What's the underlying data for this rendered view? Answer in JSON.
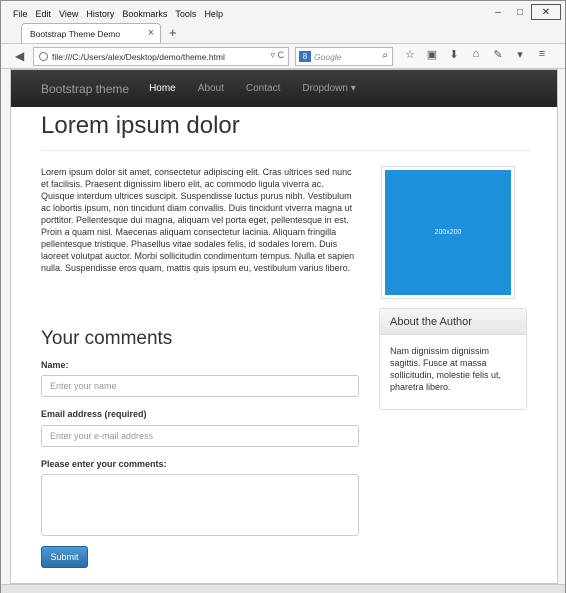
{
  "menubar": {
    "items": [
      "File",
      "Edit",
      "View",
      "History",
      "Bookmarks",
      "Tools",
      "Help"
    ]
  },
  "window_controls": {
    "minimize": "–",
    "maximize": "□",
    "close": "✕"
  },
  "tab": {
    "title": "Bootstrap Theme Demo",
    "close": "×",
    "new_tab": "+"
  },
  "address": {
    "url": "file:///C:/Users/alex/Desktop/demo/theme.html",
    "search_engine": "8",
    "search_placeholder": "Google"
  },
  "site_nav": {
    "brand": "Bootstrap theme",
    "links": [
      {
        "label": "Home",
        "active": true
      },
      {
        "label": "About",
        "active": false
      },
      {
        "label": "Contact",
        "active": false
      },
      {
        "label": "Dropdown ▾",
        "active": false
      }
    ]
  },
  "page": {
    "title": "Lorem ipsum dolor",
    "body": "Lorem ipsum dolor sit amet, consectetur adipiscing elit. Cras ultrices sed nunc et facilisis. Praesent dignissim libero elit, ac commodo ligula viverra ac. Quisque interdum ultrices suscipit. Suspendisse luctus purus nibh. Vestibulum ac lobortis ipsum, non tincidunt diam convallis. Duis tincidunt viverra magna ut porttitor. Pellentesque dui magna, aliquam vel porta eget, pellentesque in est. Proin a quam nisl. Maecenas aliquam consectetur lacinia. Aliquam fringilla pellentesque tristique. Phasellus vitae sodales felis, id sodales lorem. Duis laoreet volutpat auctor. Morbi sollicitudin condimentum tempus. Nulla et sapien nulla. Suspendisse eros quam, mattis quis ipsum eu, vestibulum varius libero."
  },
  "sidebar": {
    "image_label": "200x200",
    "panel_title": "About the Author",
    "panel_body": "Nam dignissim dignissim sagittis. Fusce at massa sollicitudin, molestie felis ut, pharetra libero."
  },
  "form": {
    "heading": "Your comments",
    "name_label": "Name:",
    "name_placeholder": "Enter your name",
    "email_label": "Email address (required)",
    "email_placeholder": "Enter your e-mail address",
    "comments_label": "Please enter your comments:",
    "submit_label": "Submit"
  },
  "colors": {
    "navbar": "#222222",
    "button": "#2b6ea8",
    "image_placeholder": "#1e90dc"
  }
}
